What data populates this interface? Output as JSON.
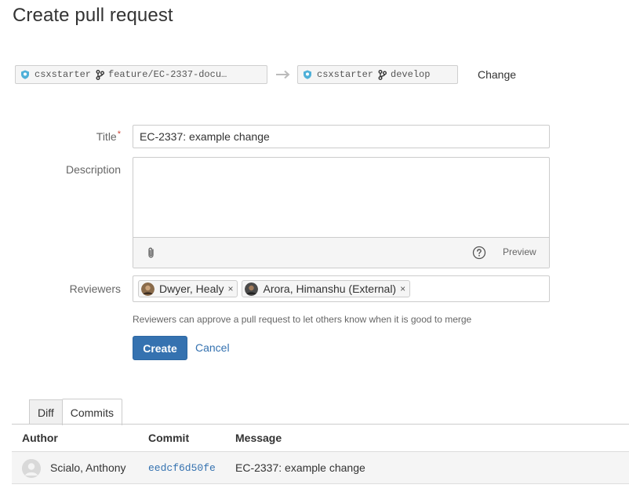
{
  "page": {
    "title": "Create pull request"
  },
  "branches": {
    "source": {
      "repo": "csxstarter",
      "branch": "feature/EC-2337-docu…"
    },
    "target": {
      "repo": "csxstarter",
      "branch": "develop"
    },
    "change_label": "Change"
  },
  "form": {
    "title_label": "Title",
    "required_marker": "*",
    "title_value": "EC-2337: example change",
    "description_label": "Description",
    "description_value": "",
    "preview_label": "Preview",
    "reviewers_label": "Reviewers",
    "reviewers": [
      {
        "name": "Dwyer, Healy",
        "remove": "×"
      },
      {
        "name": "Arora, Himanshu (External)",
        "remove": "×"
      }
    ],
    "help_text": "Reviewers can approve a pull request to let others know when it is good to merge",
    "create_label": "Create",
    "cancel_label": "Cancel"
  },
  "tabs": [
    {
      "label": "Diff",
      "active": false
    },
    {
      "label": "Commits",
      "active": true
    }
  ],
  "commits_table": {
    "columns": [
      "Author",
      "Commit",
      "Message"
    ],
    "rows": [
      {
        "author": "Scialo, Anthony",
        "commit": "eedcf6d50fe",
        "message": "EC-2337: example change"
      }
    ]
  },
  "colors": {
    "primary": "#3572b0",
    "required": "#d04437",
    "repo_icon": "#4fb0d8"
  },
  "icons": [
    "repo-icon",
    "branch-icon",
    "arrow-right-icon",
    "paperclip-icon",
    "help-icon",
    "avatar-icon"
  ]
}
